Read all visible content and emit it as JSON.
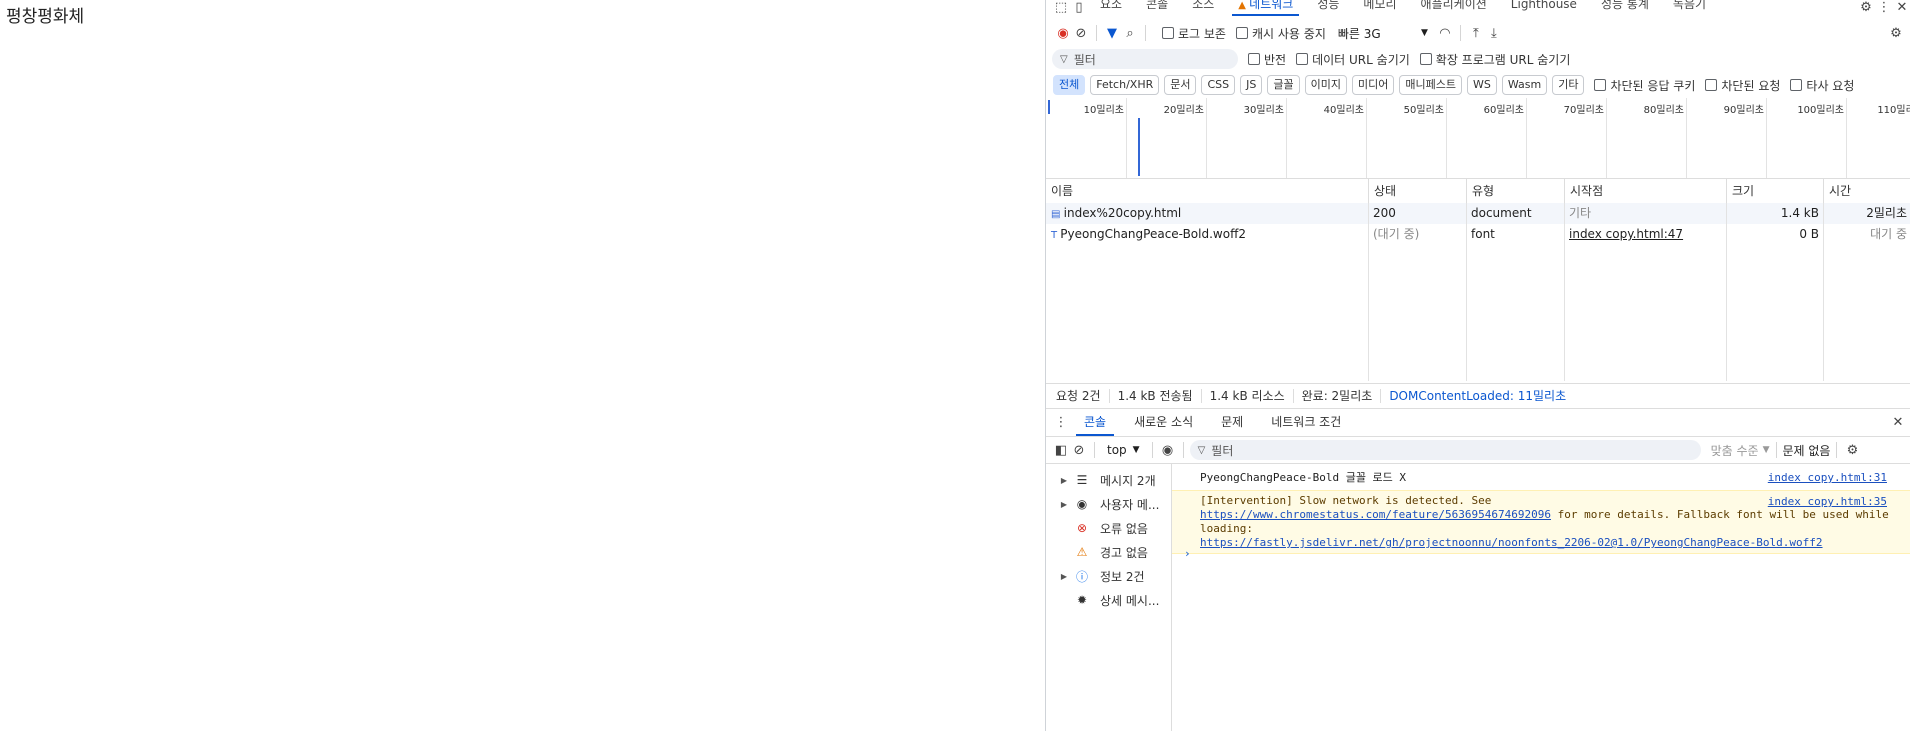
{
  "page": {
    "text": "평창평화체"
  },
  "devtools": {
    "tabs": [
      "요소",
      "콘솔",
      "소스",
      "네트워크",
      "성능",
      "메모리",
      "애플리케이션",
      "Lighthouse",
      "성능 통계",
      "녹음기"
    ],
    "active_tab": "네트워크",
    "toolbar": {
      "preserve_log": "로그 보존",
      "disable_cache": "캐시 사용 중지",
      "throttle": "빠른 3G"
    },
    "filter_bar": {
      "placeholder": "필터",
      "invert": "반전",
      "hide_data_urls": "데이터 URL 숨기기",
      "hide_ext_urls": "확장 프로그램 URL 숨기기"
    },
    "type_filters": [
      "전체",
      "Fetch/XHR",
      "문서",
      "CSS",
      "JS",
      "글꼴",
      "이미지",
      "미디어",
      "매니페스트",
      "WS",
      "Wasm",
      "기타"
    ],
    "type_filters_selected": "전체",
    "extra_filters": [
      "차단된 응답 쿠키",
      "차단된 요청",
      "타사 요청"
    ],
    "timeline_ticks": [
      "10밀리초",
      "20밀리초",
      "30밀리초",
      "40밀리초",
      "50밀리초",
      "60밀리초",
      "70밀리초",
      "80밀리초",
      "90밀리초",
      "100밀리초",
      "110밀리초"
    ],
    "table": {
      "headers": [
        "이름",
        "상태",
        "유형",
        "시작점",
        "크기",
        "시간"
      ],
      "rows": [
        {
          "name": "index%20copy.html",
          "status": "200",
          "type": "document",
          "initiator": "기타",
          "size": "1.4 kB",
          "time": "2밀리초"
        },
        {
          "name": "PyeongChangPeace-Bold.woff2",
          "status": "(대기 중)",
          "type": "font",
          "initiator": "index copy.html:47",
          "size": "0 B",
          "time": "대기 중"
        }
      ]
    },
    "summary": {
      "requests": "요청 2건",
      "transferred": "1.4 kB 전송됨",
      "resources": "1.4 kB 리소스",
      "finish": "완료: 2밀리초",
      "dcl": "DOMContentLoaded: 11밀리초"
    },
    "drawer_tabs": [
      "콘솔",
      "새로운 소식",
      "문제",
      "네트워크 조건"
    ],
    "drawer_active": "콘솔",
    "console_toolbar": {
      "context": "top",
      "filter_placeholder": "필터",
      "levels": "맞춤 수준",
      "issues": "문제 없음"
    },
    "console_sidebar": [
      {
        "label": "메시지 2개",
        "icon": "list-icon",
        "expandable": true
      },
      {
        "label": "사용자 메...",
        "icon": "user-icon",
        "expandable": true
      },
      {
        "label": "오류 없음",
        "icon": "error-icon",
        "expandable": false
      },
      {
        "label": "경고 없음",
        "icon": "warning-icon",
        "expandable": false
      },
      {
        "label": "정보 2건",
        "icon": "info-icon",
        "expandable": true
      },
      {
        "label": "상세 메시...",
        "icon": "bug-icon",
        "expandable": false
      }
    ],
    "console_messages": [
      {
        "text": "PyeongChangPeace-Bold 글꼴 로드 X",
        "source": "index copy.html:31"
      },
      {
        "text": "[Intervention] Slow network is detected. See",
        "link1": "https://www.chromestatus.com/feature/5636954674692096",
        "text2": " for more details. Fallback font will be used while loading:",
        "link2": "https://fastly.jsdelivr.net/gh/projectnoonnu/noonfonts_2206-02@1.0/PyeongChangPeace-Bold.woff2",
        "source": "index copy.html:35"
      }
    ],
    "colors": {
      "accent": "#0b57d0",
      "warn_bg": "#fffbe5",
      "record": "#d93025"
    }
  }
}
